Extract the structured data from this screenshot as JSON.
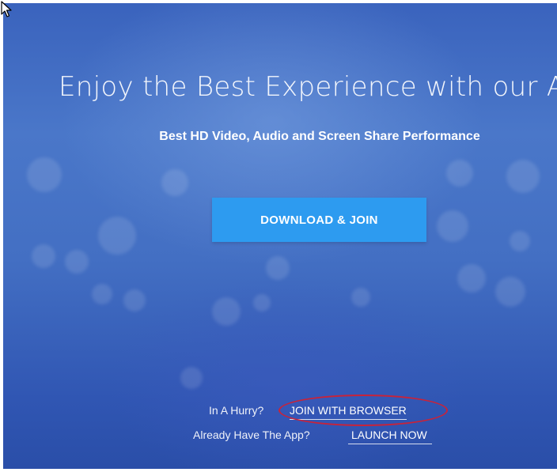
{
  "hero": {
    "headline": "Enjoy the Best Experience with our App",
    "subheadline": "Best HD Video, Audio and Screen Share Performance"
  },
  "actions": {
    "download_join_label": "DOWNLOAD & JOIN"
  },
  "alternatives": {
    "hurry_prompt": "In A Hurry?",
    "join_browser_label": "JOIN WITH BROWSER",
    "have_app_prompt": "Already Have The App?",
    "launch_now_label": "LAUNCH NOW"
  },
  "colors": {
    "background": "#4a77c9",
    "button": "#2d9bf0",
    "annotation_ellipse": "#c8233a"
  },
  "icons": {
    "cursor": "mouse-pointer-icon"
  }
}
